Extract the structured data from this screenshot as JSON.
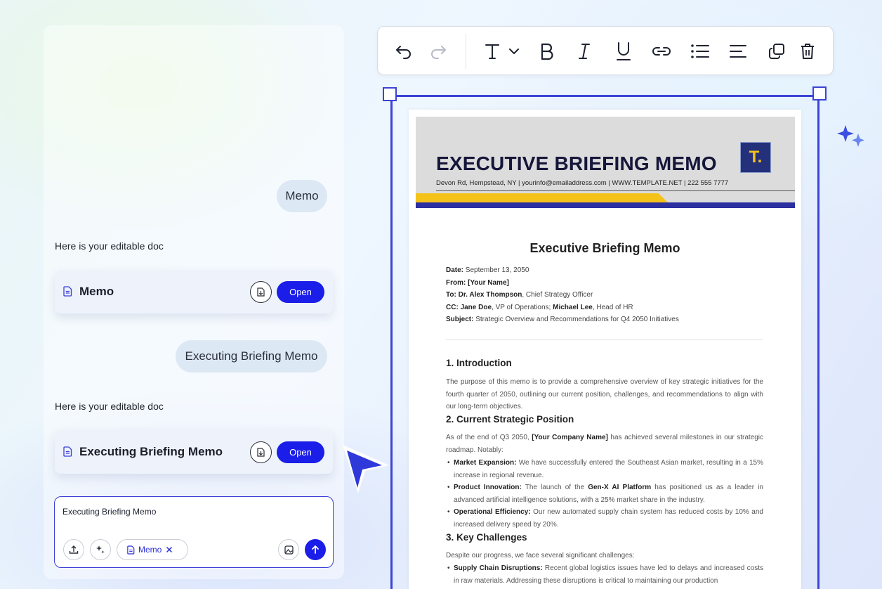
{
  "chat": {
    "messages": [
      {
        "role": "user",
        "text": "Memo"
      },
      {
        "role": "assistant",
        "text": "Here is your editable doc",
        "doc_title": "Memo",
        "open_label": "Open"
      },
      {
        "role": "user",
        "text": "Executing Briefing Memo"
      },
      {
        "role": "assistant",
        "text": "Here is your editable doc",
        "doc_title": "Executing Briefing Memo",
        "open_label": "Open"
      }
    ],
    "composer": {
      "value": "Executing Briefing Memo",
      "chip_label": "Memo"
    }
  },
  "toolbar": {
    "buttons": [
      "undo",
      "redo",
      "text-style",
      "bold",
      "italic",
      "underline",
      "link",
      "bullet-list",
      "align",
      "duplicate",
      "delete"
    ]
  },
  "colors": {
    "accent": "#1a1ee8",
    "selection": "#3b44d6",
    "banner_yellow": "#f5c21a",
    "banner_blue": "#2b2fa0"
  },
  "document": {
    "banner_title": "EXECUTIVE BRIEFING MEMO",
    "banner_contact": "Devon Rd, Hempstead, NY | yourinfo@emailaddress.com | WWW.TEMPLATE.NET | 222 555 7777",
    "logo_text": "T.",
    "title": "Executive Briefing Memo",
    "meta": {
      "date_label": "Date:",
      "date_value": "September 13, 2050",
      "from_label": "From:",
      "from_value": "[Your Name]",
      "to_label": "To:",
      "to_name": "Dr. Alex Thompson",
      "to_role": ", Chief Strategy Officer",
      "cc_label": "CC:",
      "cc_name1": "Jane Doe",
      "cc_role1": ", VP of Operations; ",
      "cc_name2": "Michael Lee",
      "cc_role2": ", Head of HR",
      "subject_label": "Subject:",
      "subject_value": "Strategic Overview and Recommendations for Q4 2050 Initiatives"
    },
    "sections": {
      "intro_heading": "1. Introduction",
      "intro_text": "The purpose of this memo is to provide a comprehensive overview of key strategic initiatives for the fourth quarter of 2050, outlining our current position, challenges, and recommendations to align with our long-term objectives.",
      "position_heading": "2. Current Strategic Position",
      "position_pre": "As of the end of Q3 2050, ",
      "position_company": "[Your Company Name]",
      "position_post": " has achieved several milestones in our strategic roadmap. Notably:",
      "b1_label": "Market Expansion:",
      "b1_text": " We have successfully entered the Southeast Asian market, resulting in a 15% increase in regional revenue.",
      "b2_label": "Product Innovation:",
      "b2_pre": " The launch of the ",
      "b2_product": "Gen-X AI Platform",
      "b2_post": " has positioned us as a leader in advanced artificial intelligence solutions, with a 25% market share in the industry.",
      "b3_label": "Operational Efficiency:",
      "b3_text": " Our new automated supply chain system has reduced costs by 10% and increased delivery speed by 20%.",
      "challenges_heading": "3. Key Challenges",
      "challenges_text": "Despite our progress, we face several significant challenges:",
      "c1_label": "Supply Chain Disruptions:",
      "c1_text": " Recent global logistics issues have led to delays and increased costs in raw materials. Addressing these disruptions is critical to maintaining our production"
    }
  }
}
